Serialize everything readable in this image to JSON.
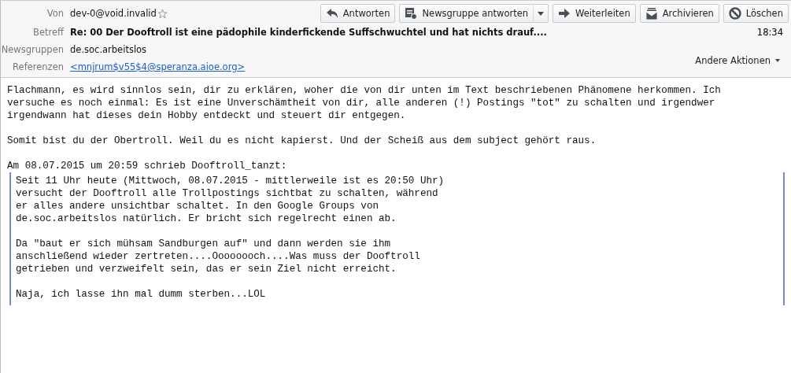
{
  "header": {
    "from": {
      "label": "Von",
      "value": "dev-0@void.invalid"
    },
    "subject": {
      "label": "Betreff",
      "value": "Re: 00 Der Dooftroll ist eine pädophile kinderfickende Suffschwuchtel und hat nichts drauf....",
      "time": "18:34"
    },
    "newsgroups": {
      "label": "Newsgruppen",
      "value": "de.soc.arbeitslos"
    },
    "references": {
      "label": "Referenzen",
      "value": "<mnjrum$v55$4@speranza.aioe.org>"
    },
    "other_actions": "Andere Aktionen",
    "buttons": [
      {
        "kind": "reply",
        "label": "Antworten"
      },
      {
        "kind": "reply-group",
        "label": "Newsgruppe antworten",
        "dropdown": true
      },
      {
        "kind": "forward",
        "label": "Weiterleiten"
      },
      {
        "kind": "archive",
        "label": "Archivieren"
      },
      {
        "kind": "delete",
        "label": "Löschen"
      }
    ]
  },
  "body": {
    "paragraphs": [
      [
        "Flachmann, es wird sinnlos sein, dir zu erklären, woher die von dir unten im Text beschriebenen Phänomene herkommen. Ich",
        "versuche es noch einmal: Es ist eine Unverschämtheit von dir, alle anderen (!) Postings \"tot\" zu schalten und irgendwer",
        "irgendwann hat dieses dein Hobby entdeckt und steuert dir entgegen."
      ],
      [
        "Somit bist du der Obertroll. Weil du es nicht kapierst. Und der Scheiß aus dem subject gehört raus."
      ],
      [
        "Am 08.07.2015 um 20:59 schrieb Dooftroll_tanzt:"
      ]
    ],
    "quote": [
      [
        "Seit 11 Uhr heute (Mittwoch, 08.07.2015 - mittlerweile ist es 20:50 Uhr)",
        "versucht der Dooftroll alle Trollpostings sichtbat zu schalten, während",
        "er alles andere unsichtbar schaltet. In den Google Groups von",
        "de.soc.arbeitslos natürlich. Er bricht sich regelrecht einen ab."
      ],
      [
        "Da \"baut er sich mühsam Sandburgen auf\" und dann werden sie ihm",
        "anschließend wieder zertreten....Oooooooch....Was muss der Dooftroll",
        "getrieben und verzweifelt sein, das er sein Ziel nicht erreicht."
      ],
      [
        "Naja, ich lasse ihn mal dumm sterben...LOL"
      ]
    ]
  }
}
